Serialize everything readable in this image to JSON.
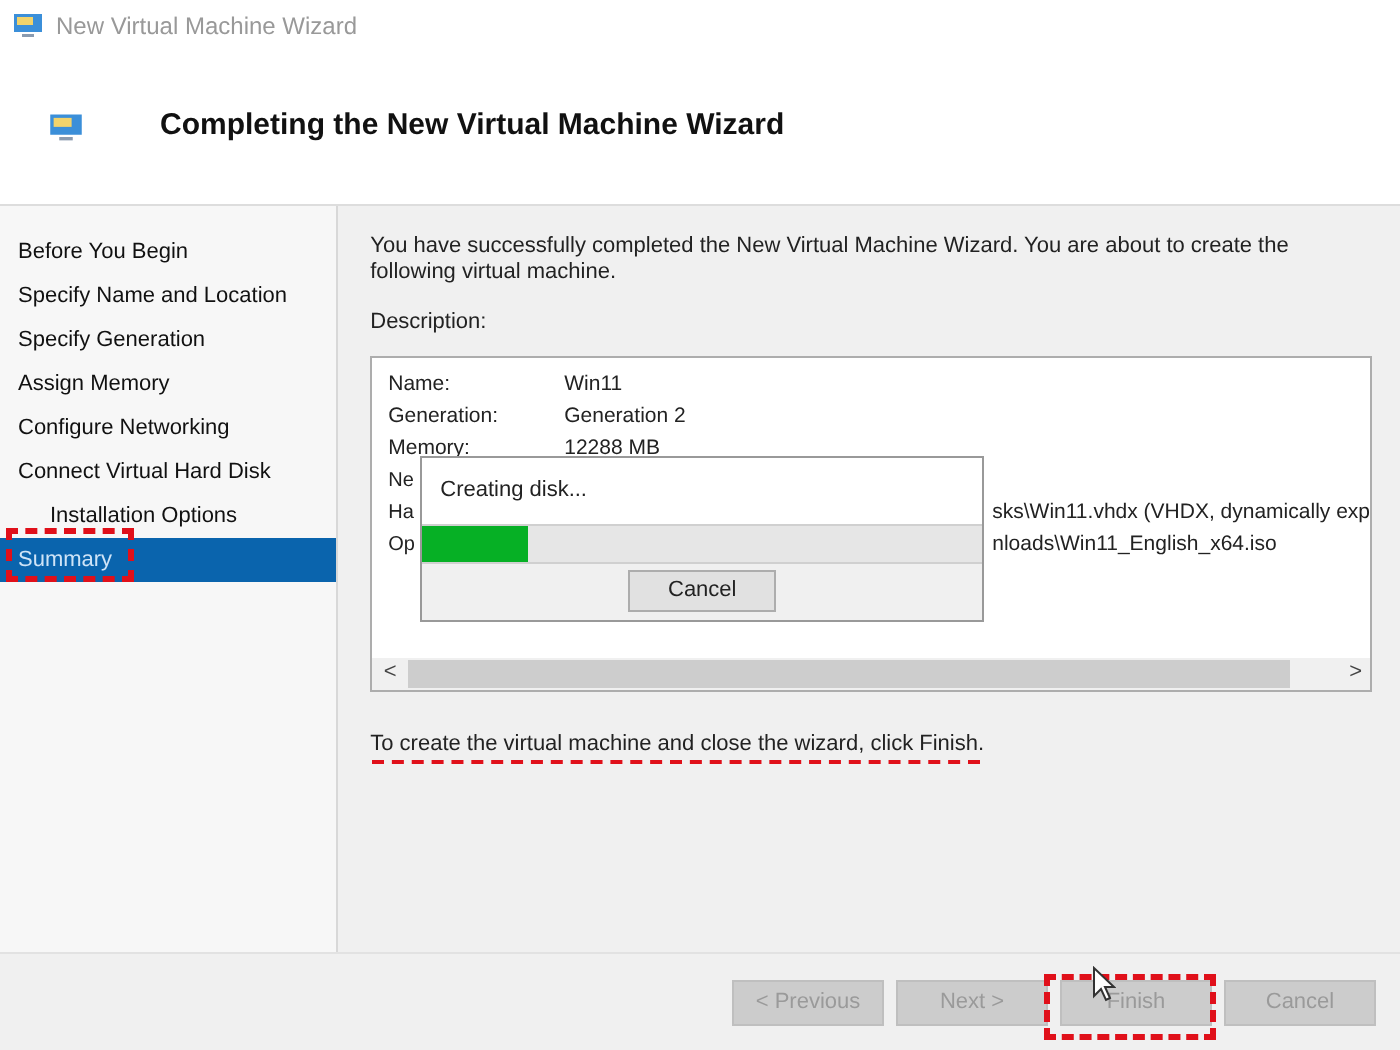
{
  "window": {
    "title": "New Virtual Machine Wizard"
  },
  "header": {
    "title": "Completing the New Virtual Machine Wizard"
  },
  "sidebar": {
    "items": [
      {
        "label": "Before You Begin",
        "selected": false
      },
      {
        "label": "Specify Name and Location",
        "selected": false
      },
      {
        "label": "Specify Generation",
        "selected": false
      },
      {
        "label": "Assign Memory",
        "selected": false
      },
      {
        "label": "Configure Networking",
        "selected": false
      },
      {
        "label": "Connect Virtual Hard Disk",
        "selected": false,
        "children": [
          {
            "label": "Installation Options",
            "selected": false
          }
        ]
      },
      {
        "label": "Summary",
        "selected": true
      }
    ]
  },
  "intro": "You have successfully completed the New Virtual Machine Wizard. You are about to create the following virtual machine.",
  "description": {
    "label": "Description:",
    "rows": [
      {
        "kind": "full",
        "label": "Name:",
        "value": "Win11"
      },
      {
        "kind": "full",
        "label": "Generation:",
        "value": "Generation 2"
      },
      {
        "kind": "full",
        "label": "Memory:",
        "value": "12288 MB"
      },
      {
        "kind": "covered",
        "label": "Ne"
      },
      {
        "kind": "covered",
        "label": "Ha",
        "value": "sks\\Win11.vhdx (VHDX, dynamically exp"
      },
      {
        "kind": "covered",
        "label": "Op",
        "value": "nloads\\Win11_English_x64.iso"
      }
    ],
    "scroll_left": "<",
    "scroll_right": ">"
  },
  "progress_dialog": {
    "message": "Creating disk...",
    "level": 0.19,
    "cancel": "Cancel"
  },
  "footer_note": "To create the virtual machine and close the wizard, click Finish.",
  "buttons": [
    {
      "label": "< Previous",
      "disabled": true
    },
    {
      "label": "Next >",
      "disabled": true
    },
    {
      "label": "Finish",
      "disabled": true
    },
    {
      "label": "Cancel",
      "disabled": true
    }
  ]
}
